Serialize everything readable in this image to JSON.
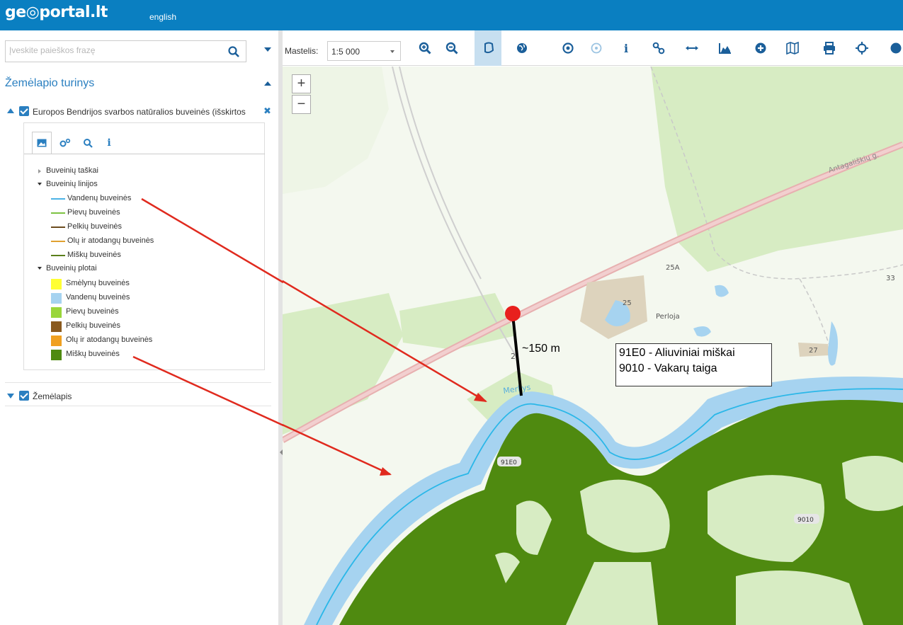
{
  "header": {
    "logo": "ge◎portal.lt",
    "language_link": "english"
  },
  "search": {
    "placeholder": "Įveskite paieškos frazę"
  },
  "panel": {
    "title": "Žemėlapio turinys",
    "layer1": {
      "label": "Europos Bendrijos svarbos natūralios buveinės (išskirtos"
    },
    "layer2": {
      "label": "Žemėlapis"
    },
    "groups": [
      {
        "label": "Buveinių taškai"
      },
      {
        "label": "Buveinių linijos",
        "items": [
          {
            "label": "Vandenų buveinės",
            "color": "#4db3e6"
          },
          {
            "label": "Pievų buveinės",
            "color": "#7dc242"
          },
          {
            "label": "Pelkių buveinės",
            "color": "#6b4b1e"
          },
          {
            "label": "Olų ir atodangų buveinės",
            "color": "#e0a030"
          },
          {
            "label": "Miškų buveinės",
            "color": "#5a7f1a"
          }
        ]
      },
      {
        "label": "Buveinių plotai",
        "items": [
          {
            "label": "Smėlynų buveinės",
            "color": "#ffff33"
          },
          {
            "label": "Vandenų buveinės",
            "color": "#a6d3f0"
          },
          {
            "label": "Pievų buveinės",
            "color": "#9ad63a"
          },
          {
            "label": "Pelkių buveinės",
            "color": "#8a5a1e"
          },
          {
            "label": "Olų ir atodangų buveinės",
            "color": "#f0a020"
          },
          {
            "label": "Miškų buveinės",
            "color": "#4f8a10"
          }
        ]
      }
    ]
  },
  "toolbar": {
    "scale_label": "Mastelis:",
    "scale_value": "1:5 000",
    "tools": [
      "zoom-in-icon",
      "zoom-out-icon",
      "lasso-icon",
      "globe-icon",
      "target-icon",
      "target-disabled-icon",
      "info-icon",
      "link-icon",
      "measure-icon",
      "profile-icon",
      "add-icon",
      "map-icon",
      "print-icon",
      "locate-icon"
    ]
  },
  "map": {
    "zoom_in": "+",
    "zoom_out": "−",
    "distance_label": "~150 m",
    "annotation": [
      "91E0 - Aliuviniai miškai",
      "9010 - Vakarų taiga"
    ],
    "labels": {
      "street": "Antagališkių g.",
      "house_25a": "25A",
      "house_33": "33",
      "house_25": "25",
      "house_27": "27",
      "perloja": "Perloja",
      "river": "Merkys",
      "num_small": "2",
      "habitat_91e0": "91E0",
      "habitat_9010": "9010"
    },
    "colors": {
      "forest": "#4f8a10",
      "meadow": "#d9edc4",
      "river": "#a6d3f0",
      "road": "#e6a7a7",
      "pin": "#e8201d",
      "arrow": "#e02a1e"
    }
  }
}
